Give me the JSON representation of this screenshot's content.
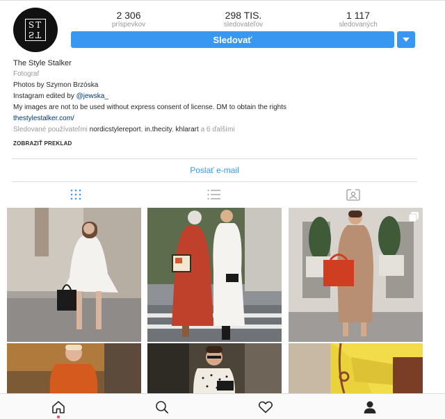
{
  "profile": {
    "avatar_text_top": "ST",
    "avatar_text_bottom": "ST",
    "stats": [
      {
        "value": "2 306",
        "label": "príspevkov"
      },
      {
        "value": "298 TIS.",
        "label": "sledovateľov"
      },
      {
        "value": "1 117",
        "label": "sledovaných"
      }
    ],
    "follow_label": "Sledovať",
    "name": "The Style Stalker",
    "category": "Fotograf",
    "bio_line1": "Photos by Szymon Brzóska",
    "bio_line2_prefix": "Instagram edited by ",
    "bio_line2_mention": "@jewska_",
    "bio_line3": "My images are not to be used without express consent of license. DM to obtain the rights",
    "website": "thestylestalker.com/",
    "followed_prefix": "Sledované používateľmi ",
    "followed_users": [
      "nordicstylereport",
      "in.thecity",
      "khlarart"
    ],
    "followed_suffix": " a 6 ďalšími",
    "translate": "ZOBRAZIŤ PREKLAD",
    "email_label": "Poslať e-mail"
  },
  "tabs": [
    {
      "icon": "grid-icon",
      "active": true
    },
    {
      "icon": "list-icon",
      "active": false
    },
    {
      "icon": "tagged-icon",
      "active": false
    }
  ],
  "posts": [
    {
      "desc": "white-dress-street",
      "multi": false
    },
    {
      "desc": "red-coat-white-coat-duo",
      "multi": false
    },
    {
      "desc": "camel-coat-red-bag",
      "multi": true
    },
    {
      "desc": "orange-knit-autumn",
      "multi": false
    },
    {
      "desc": "polka-dot-blouse-cafe",
      "multi": false
    },
    {
      "desc": "yellow-jacket-detail",
      "multi": false
    }
  ],
  "bottom_nav": [
    {
      "icon": "home-icon"
    },
    {
      "icon": "search-icon"
    },
    {
      "icon": "heart-icon"
    },
    {
      "icon": "profile-icon"
    }
  ],
  "colors": {
    "accent": "#3897f0",
    "text": "#262626",
    "muted": "#999999",
    "link": "#003569",
    "notification": "#ed4956"
  }
}
